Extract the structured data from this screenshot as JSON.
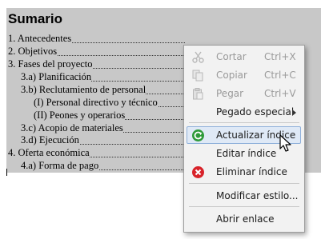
{
  "document": {
    "title": "Sumario",
    "entries": [
      {
        "label": "1.  Antecedentes"
      },
      {
        "label": "2.  Objetivos"
      },
      {
        "label": "3.  Fases del proyecto"
      },
      {
        "label": "3.a)  Planificación"
      },
      {
        "label": "3.b)  Reclutamiento de personal"
      },
      {
        "label": "(I) Personal directivo y técnico"
      },
      {
        "label": "(II) Peones y operarios"
      },
      {
        "label": "3.c)  Acopio de materiales"
      },
      {
        "label": "3.d)  Ejecución"
      },
      {
        "label": "4.  Oferta económica"
      },
      {
        "label": "4.a)  Forma de pago"
      }
    ]
  },
  "context_menu": {
    "items": [
      {
        "label": "Cortar",
        "shortcut": "Ctrl+X",
        "icon": "scissors-icon",
        "enabled": false
      },
      {
        "label": "Copiar",
        "shortcut": "Ctrl+C",
        "icon": "copy-icon",
        "enabled": false
      },
      {
        "label": "Pegar",
        "shortcut": "Ctrl+V",
        "icon": "paste-icon",
        "enabled": false
      },
      {
        "label": "Pegado especial",
        "shortcut": "",
        "icon": "",
        "enabled": true,
        "submenu": true
      },
      {
        "label": "Actualizar índice",
        "shortcut": "",
        "icon": "refresh-icon",
        "enabled": true,
        "highlighted": true
      },
      {
        "label": "Editar índice",
        "shortcut": "",
        "icon": "",
        "enabled": true
      },
      {
        "label": "Eliminar índice",
        "shortcut": "",
        "icon": "delete-icon",
        "enabled": true
      },
      {
        "label": "Modificar estilo...",
        "shortcut": "",
        "icon": "",
        "enabled": true
      },
      {
        "label": "Abrir enlace",
        "shortcut": "",
        "icon": "",
        "enabled": true
      }
    ]
  },
  "colors": {
    "index_background": "#c8c8c8",
    "menu_background": "#f2f2f2",
    "highlight": "#dfe9f6",
    "refresh_green": "#2e9a3a",
    "delete_red": "#d8232a"
  }
}
